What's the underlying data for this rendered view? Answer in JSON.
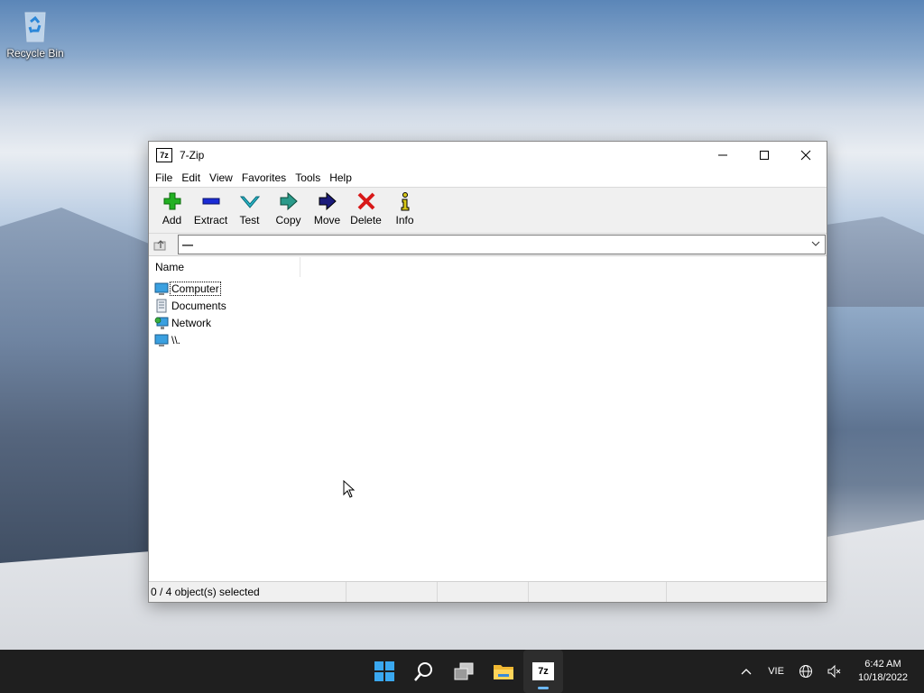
{
  "desktop": {
    "recycle_bin_label": "Recycle Bin"
  },
  "window": {
    "app_icon_text": "7z",
    "title": "7-Zip",
    "menu": [
      "File",
      "Edit",
      "View",
      "Favorites",
      "Tools",
      "Help"
    ],
    "toolbar": [
      {
        "label": "Add",
        "icon": "add-icon",
        "color": "#22b022"
      },
      {
        "label": "Extract",
        "icon": "extract-icon",
        "color": "#1a2bd6"
      },
      {
        "label": "Test",
        "icon": "test-icon",
        "color": "#2ab8c8"
      },
      {
        "label": "Copy",
        "icon": "copy-icon",
        "color": "#2a9a8a"
      },
      {
        "label": "Move",
        "icon": "move-icon",
        "color": "#1a1a7a"
      },
      {
        "label": "Delete",
        "icon": "delete-icon",
        "color": "#d81818"
      },
      {
        "label": "Info",
        "icon": "info-icon",
        "color": "#d8c818"
      }
    ],
    "address": {
      "value": "—"
    },
    "list": {
      "column_name": "Name",
      "items": [
        {
          "name": "Computer",
          "icon": "computer-icon"
        },
        {
          "name": "Documents",
          "icon": "documents-icon"
        },
        {
          "name": "Network",
          "icon": "network-icon"
        },
        {
          "name": "\\\\.",
          "icon": "computer-icon"
        }
      ]
    },
    "status": {
      "selection": "0 / 4 object(s) selected"
    }
  },
  "taskbar": {
    "sevenzip_icon_text": "7z",
    "language": "VIE",
    "time": "6:42 AM",
    "date": "10/18/2022"
  }
}
